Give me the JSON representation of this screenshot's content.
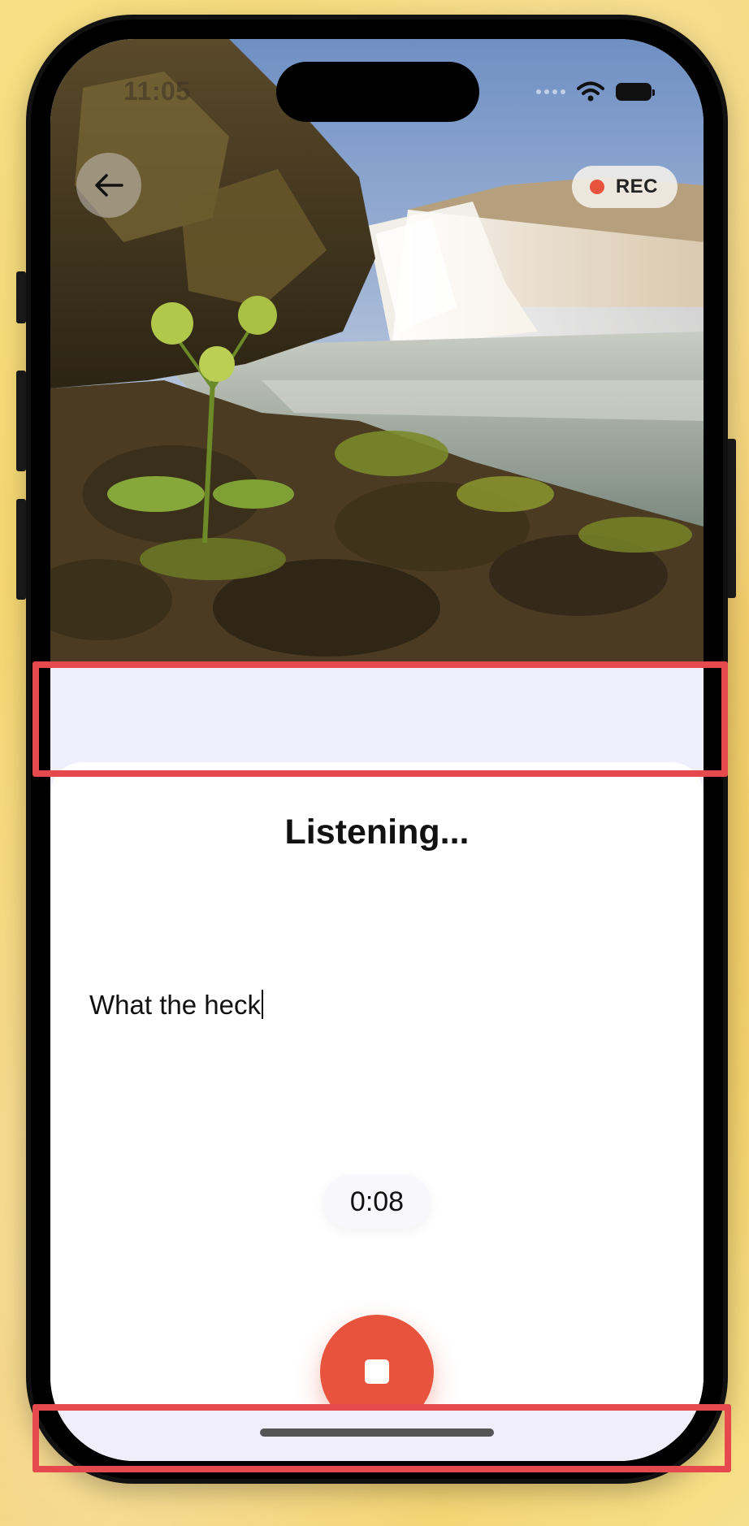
{
  "status_bar": {
    "time": "11:05"
  },
  "header": {
    "back_icon": "arrow-left-icon"
  },
  "rec_badge": {
    "label": "REC",
    "dot_color": "#e8533d"
  },
  "sheet": {
    "title": "Listening...",
    "transcript": "What the heck",
    "timer": "0:08"
  },
  "controls": {
    "stop_icon": "stop-icon",
    "accent": "#e8533d"
  },
  "colors": {
    "highlight": "#e5484d",
    "lavender": "#efeefb"
  }
}
